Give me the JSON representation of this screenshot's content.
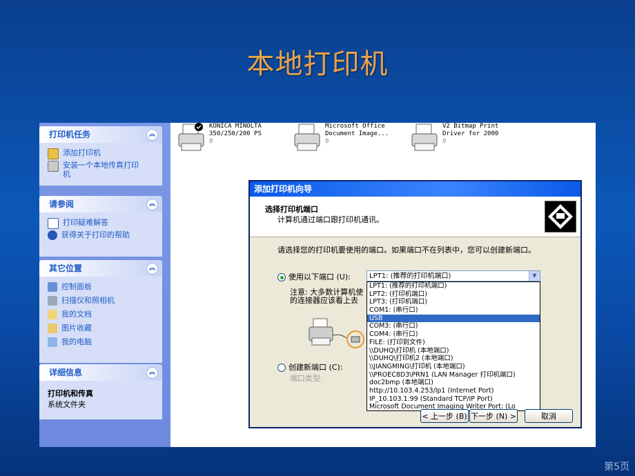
{
  "slide": {
    "title": "本地打印机",
    "page_number": "第5页"
  },
  "taskpane": {
    "printer_tasks": {
      "header": "打印机任务",
      "items": [
        "添加打印机",
        "安装一个本地传真打印机"
      ]
    },
    "see_also": {
      "header": "请参阅",
      "items": [
        "打印疑难解答",
        "获得关于打印的帮助"
      ]
    },
    "other_places": {
      "header": "其它位置",
      "items": [
        "控制面板",
        "扫描仪和照相机",
        "我的文档",
        "图片收藏",
        "我的电脑"
      ]
    },
    "details": {
      "header": "详细信息",
      "title": "打印机和传真",
      "subtitle": "系统文件夹"
    }
  },
  "printers": [
    {
      "line1": "KONICA MINOLTA",
      "line2": "350/250/200 PS",
      "count": "0"
    },
    {
      "line1": "Microsoft Office",
      "line2": "Document Image...",
      "count": "0"
    },
    {
      "line1": "V2 Bitmap Print",
      "line2": "Driver for 2000",
      "count": "0"
    }
  ],
  "wizard": {
    "title": "添加打印机向导",
    "header_title": "选择打印机端口",
    "header_subtitle": "计算机通过端口跟打印机通讯。",
    "instruction": "请选择您的打印机要使用的端口。如果端口不在列表中，您可以创建新端口。",
    "use_port_label": "使用以下端口 (U):",
    "selected_port": "LPT1: (推荐的打印机端口)",
    "note_line1": "注意: 大多数计算机使",
    "note_line2": "的连接器应该看上去",
    "create_port_label": "创建新端口 (C):",
    "port_type_label": "端口类型:",
    "back_button": "< 上一步 (B)",
    "next_button": "下一步 (N) >",
    "cancel_button": "取消",
    "port_options": [
      "LPT1: (推荐的打印机端口)",
      "LPT2: (打印机端口)",
      "LPT3: (打印机端口)",
      "COM1: (串行口)",
      "USB",
      "COM3: (串行口)",
      "COM4: (串行口)",
      "FILE: (打印到文件)",
      "\\\\DUHQ\\打印机 (本地端口)",
      "\\\\DUHQ\\打印机2 (本地端口)",
      "\\\\JIANGMING\\打印机 (本地端口)",
      "\\\\PROEC8D3\\PRN1 (LAN Manager 打印机端口)",
      "doc2bmp (本地端口)",
      "http://10.103.4.253/lp1 (Internet Port)",
      "IP_10.103.1.99 (Standard TCP/IP Port)",
      "Microsoft Document Imaging Writer Port: (Lo"
    ],
    "selected_option_index": 4
  }
}
